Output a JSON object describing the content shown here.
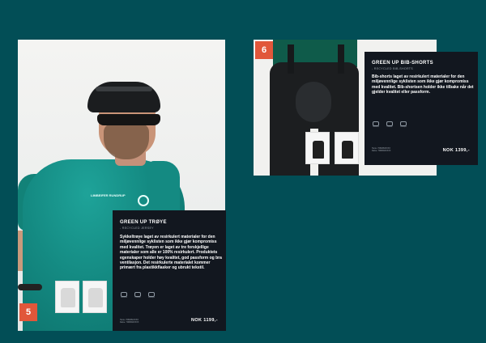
{
  "left_page": {
    "number": "5",
    "product": {
      "title": "GREEN UP TRØYE",
      "subtitle": "- RECYCLED JERSEY",
      "description": "Sykkeltrøye laget av resirkulert materialer for den miljøvennlige syklisten som ikke gjør kompromiss med kvalitet. Trøyen er laget av tre forskjellige materialer som alle er 100% resirkulert. Produktets egenskaper holder høy kvalitet, god passform og bra ventilasjon. Det resirkulerte materialet kommer primært fra plastikkflasker og ubrukt tekstil.",
      "icons": [
        {
          "name": "recycle-icon",
          "label": "Resirkulert"
        },
        {
          "name": "fit-icon",
          "label": "Passform"
        },
        {
          "name": "ventilation-icon",
          "label": "Ventilasjon"
        }
      ],
      "article_lines": [
        "Herre: 7080361XXXX",
        "Dame: 7080362XXXX"
      ],
      "price": "NOK 1199,-"
    },
    "chest_text": "LIMBEIFER RUNDRUP"
  },
  "right_page": {
    "number": "6",
    "product": {
      "title": "GREEN UP BIB-SHORTS",
      "subtitle": "- RECYCLED BIB-SHORTS",
      "description": "Bib-shorts laget av resirkulert materialer for den miljøvennlige syklisten som ikke gjør kompromiss med kvalitet. Bib-shortsen holder ikke tilbake når det gjelder kvalitet eller passform.",
      "icons": [
        {
          "name": "recycle-icon",
          "label": "Resirkulert"
        },
        {
          "name": "fit-icon",
          "label": "Passform"
        },
        {
          "name": "ventilation-icon",
          "label": "Ventilasjon"
        }
      ],
      "article_lines": [
        "Herre: 7080363XXXX",
        "Dame: 7080364XXXX"
      ],
      "price": "NOK 1399,-"
    }
  },
  "colors": {
    "background": "#024e56",
    "panel": "#12171f",
    "page_number": "#e1573a",
    "jersey": "#148a82"
  }
}
